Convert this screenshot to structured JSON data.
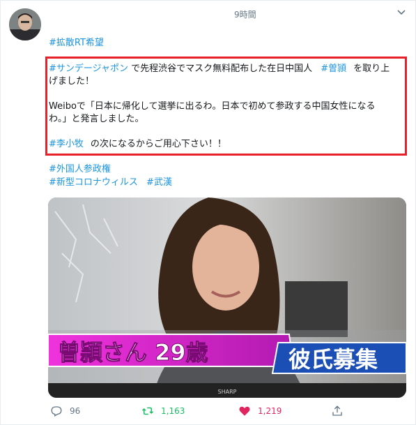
{
  "tweet": {
    "time": "9時間",
    "hashtag_top": "#拡散RT希望",
    "p1_tag1": "#サンデージャポン",
    "p1_text1": " で先程渋谷でマスク無料配布した在日中国人 ",
    "p1_tag2": "#曽頴",
    "p1_text2": "を取り上",
    "p1_line2": "げました！",
    "p2_line1": "Weiboで「日本に帰化して選挙に出るわ。日本で初めて参政する中国女性になる",
    "p2_line2": "わ。」と発言しました。",
    "p3_tag": "#李小牧",
    "p3_text": "の次になるからご用心下さい！！",
    "tag_foreign": "#外国人参政権",
    "tag_corona": "#新型コロナウィルス",
    "tag_wuhan": "#武漢"
  },
  "image": {
    "caption_left": "曽頴さん 29歳",
    "caption_right": "彼氏募集",
    "tv_brand": "SHARP"
  },
  "actions": {
    "reply_count": "96",
    "retweet_count": "1,163",
    "like_count": "1,219"
  },
  "colors": {
    "link": "#1b95e0",
    "highlight_border": "#e8202a",
    "retweet": "#17bf63",
    "like": "#e0245e",
    "caption_pink": "#d21fc4",
    "caption_blue": "#1b4fb5"
  },
  "icons": [
    "avatar",
    "chevron-down-icon",
    "reply-icon",
    "retweet-icon",
    "heart-icon",
    "share-icon"
  ]
}
